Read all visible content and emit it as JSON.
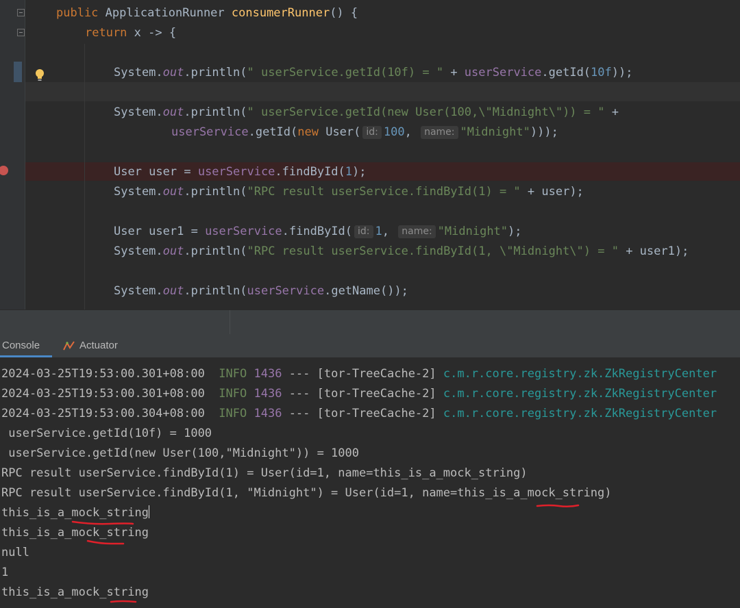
{
  "editor": {
    "lines": {
      "l1": {
        "kw": "public",
        "type": " ApplicationRunner ",
        "method": "consumerRunner",
        "rest": "() {"
      },
      "l2": {
        "kw": "return",
        "rest": " x -> {"
      },
      "l3": {
        "a": "System.",
        "b": "out",
        "c": ".println(",
        "d": "\" userService.getId(10f) = \"",
        "e": " + ",
        "f": "userService",
        "g": ".getId(",
        "h": "10f",
        "i": "));"
      },
      "l4": {
        "a": "System.",
        "b": "out",
        "c": ".println(",
        "d": "\" userService.getId(new User(100,\\\"Midnight\\\")) = \"",
        "e": " +"
      },
      "l5": {
        "a": "userService",
        "b": ".getId(",
        "c": "new",
        "d": " User(",
        "hint_id": "id:",
        "e": "100",
        "f": ", ",
        "hint_name": "name:",
        "g": "\"Midnight\"",
        "h": ")));"
      },
      "l6": {
        "a": "User user = ",
        "b": "userService",
        "c": ".findById(",
        "d": "1",
        "e": ");"
      },
      "l7": {
        "a": "System.",
        "b": "out",
        "c": ".println(",
        "d": "\"RPC result userService.findById(1) = \"",
        "e": " + user);"
      },
      "l8": {
        "a": "User user1 = ",
        "b": "userService",
        "c": ".findById(",
        "hint_id": "id:",
        "d": "1",
        "e": ", ",
        "hint_name": "name:",
        "f": "\"Midnight\"",
        "g": ");"
      },
      "l9": {
        "a": "System.",
        "b": "out",
        "c": ".println(",
        "d": "\"RPC result userService.findById(1, \\\"Midnight\\\") = \"",
        "e": " + user1);"
      },
      "l10": {
        "a": "System.",
        "b": "out",
        "c": ".println(",
        "d": "userService",
        "e": ".getName());"
      }
    }
  },
  "tabs": {
    "console": "Console",
    "actuator": "Actuator"
  },
  "console": {
    "log_rows": [
      {
        "ts": "2024-03-25T19:53:00.301+08:00",
        "level": "INFO",
        "pid": "1436",
        "sep": " --- ",
        "thread": "[tor-TreeCache-2]",
        "logger": "c.m.r.core.registry.zk.ZkRegistryCenter"
      },
      {
        "ts": "2024-03-25T19:53:00.301+08:00",
        "level": "INFO",
        "pid": "1436",
        "sep": " --- ",
        "thread": "[tor-TreeCache-2]",
        "logger": "c.m.r.core.registry.zk.ZkRegistryCenter"
      },
      {
        "ts": "2024-03-25T19:53:00.304+08:00",
        "level": "INFO",
        "pid": "1436",
        "sep": " --- ",
        "thread": "[tor-TreeCache-2]",
        "logger": "c.m.r.core.registry.zk.ZkRegistryCenter"
      }
    ],
    "output": [
      " userService.getId(10f) = 1000",
      " userService.getId(new User(100,\"Midnight\")) = 1000",
      "RPC result userService.findById(1) = User(id=1, name=this_is_a_mock_string)",
      "RPC result userService.findById(1, \"Midnight\") = User(id=1, name=this_is_a_mock_string)",
      "this_is_a_mock_string",
      "this_is_a_mock_string",
      "null",
      "1",
      "this_is_a_mock_string"
    ]
  },
  "colors": {
    "annotation_red": "#e0202a",
    "breakpoint": "#c75450",
    "background": "#2b2b2b"
  },
  "icons": [
    "fold-icon",
    "breakpoint-icon",
    "lightbulb-icon",
    "actuator-icon"
  ]
}
